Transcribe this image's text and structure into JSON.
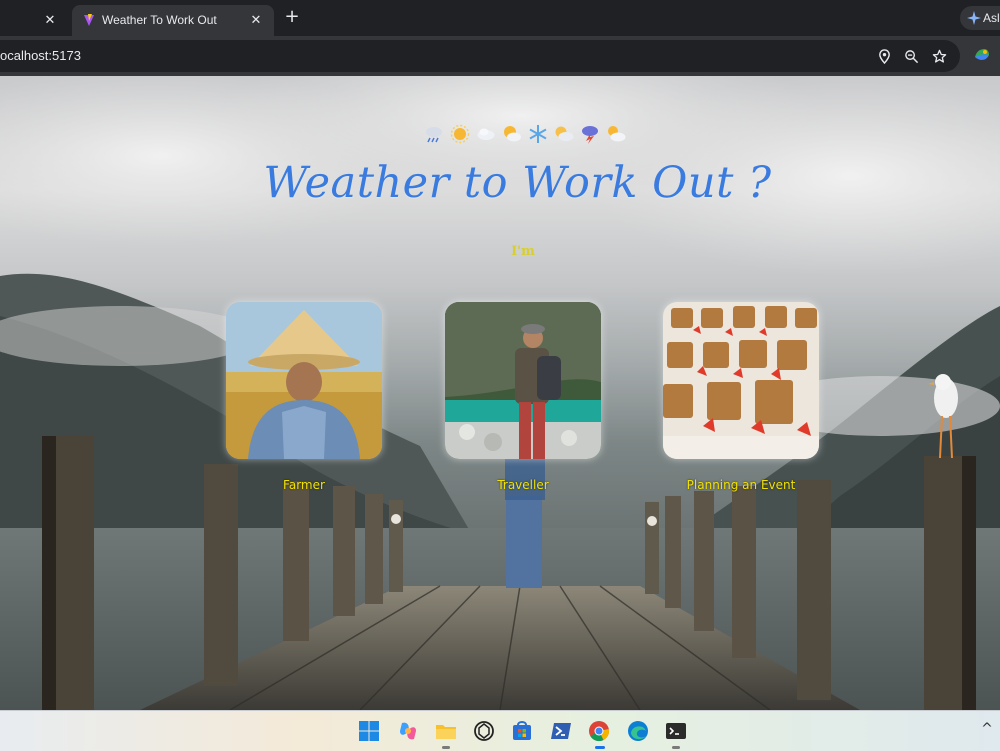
{
  "browser": {
    "inactive_tab": {
      "close_glyph": "✕"
    },
    "active_tab": {
      "title": "Weather To Work Out",
      "close_glyph": "✕"
    },
    "new_tab_glyph": "+",
    "profile_label": "Asl",
    "address": "ocalhost:5173",
    "toolbar_icons": [
      "location-icon",
      "zoom-out-icon",
      "bookmark-star-icon",
      "extension-icon"
    ]
  },
  "page": {
    "weather_icons": [
      "rain-cloud-icon",
      "sun-icon",
      "cloud-icon",
      "sun-behind-cloud-icon",
      "snowflake-icon",
      "partly-cloudy-icon",
      "thunderstorm-icon",
      "sun-small-cloud-icon"
    ],
    "title": "Weather to Work Out ?",
    "subtitle": "I'm",
    "options": [
      {
        "id": "farmer",
        "label": "Farmer"
      },
      {
        "id": "traveller",
        "label": "Traveller"
      },
      {
        "id": "event",
        "label": "Planning an Event"
      }
    ]
  },
  "taskbar": {
    "chevron_glyph": "^",
    "apps": [
      "windows-start-icon",
      "copilot-icon",
      "file-explorer-icon",
      "chatgpt-icon",
      "microsoft-store-icon",
      "powershell-icon",
      "chrome-icon",
      "edge-icon",
      "terminal-icon"
    ]
  },
  "colors": {
    "title": "#3a7be0",
    "label_yellow": "#f2e200",
    "im_label": "#d8cf2e"
  }
}
